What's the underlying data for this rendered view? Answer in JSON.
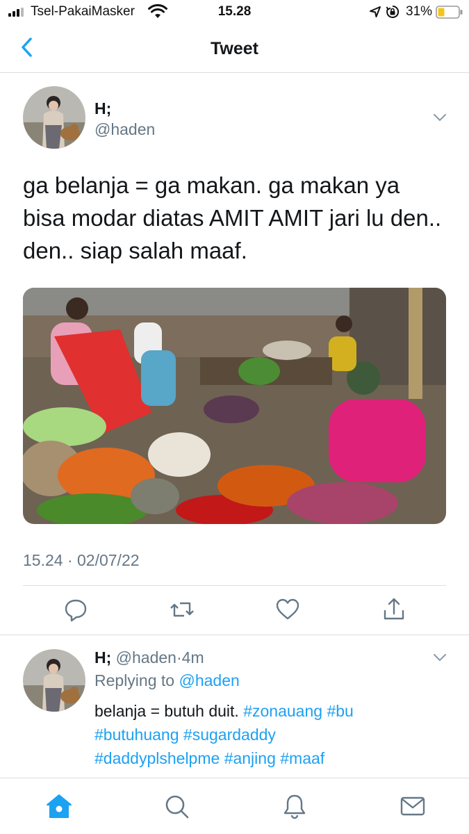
{
  "status_bar": {
    "carrier": "Tsel-PakaiMasker",
    "time": "15.28",
    "battery": "31%",
    "icons": [
      "signal-icon",
      "wifi-icon",
      "location-icon",
      "orientation-lock-icon",
      "battery-icon"
    ]
  },
  "header": {
    "title": "Tweet",
    "back_icon": "back-chevron-icon"
  },
  "tweet": {
    "name": "H;",
    "handle": "@haden",
    "text": "ga belanja = ga makan. ga makan ya bisa modar diatas AMIT AMIT jari lu den.. den.. siap salah maaf.",
    "media": "photo of a traditional market with vegetables and chili peppers",
    "timestamp": "15.24 · 02/07/22",
    "actions": [
      "reply-icon",
      "retweet-icon",
      "like-icon",
      "share-icon"
    ]
  },
  "reply": {
    "name": "H;",
    "handle": "@haden",
    "separator": "·",
    "age": "4m",
    "replying_prefix": "Replying to ",
    "replying_to": "@haden",
    "text_plain": "belanja = butuh duit. ",
    "hashtags_line1": [
      "#zonauang",
      "#bu"
    ],
    "hashtags_line2": [
      "#butuhuang",
      "#sugardaddy"
    ],
    "hashtags_line3": [
      "#daddyplshelpme",
      "#anjing",
      "#maaf"
    ]
  },
  "tab_bar": {
    "tabs": [
      "home-icon",
      "search-icon",
      "notifications-icon",
      "messages-icon"
    ],
    "active": "home-icon"
  },
  "colors": {
    "accent": "#1da1f2",
    "text": "#14171a",
    "secondary": "#657786",
    "divider": "#d9dde1"
  }
}
